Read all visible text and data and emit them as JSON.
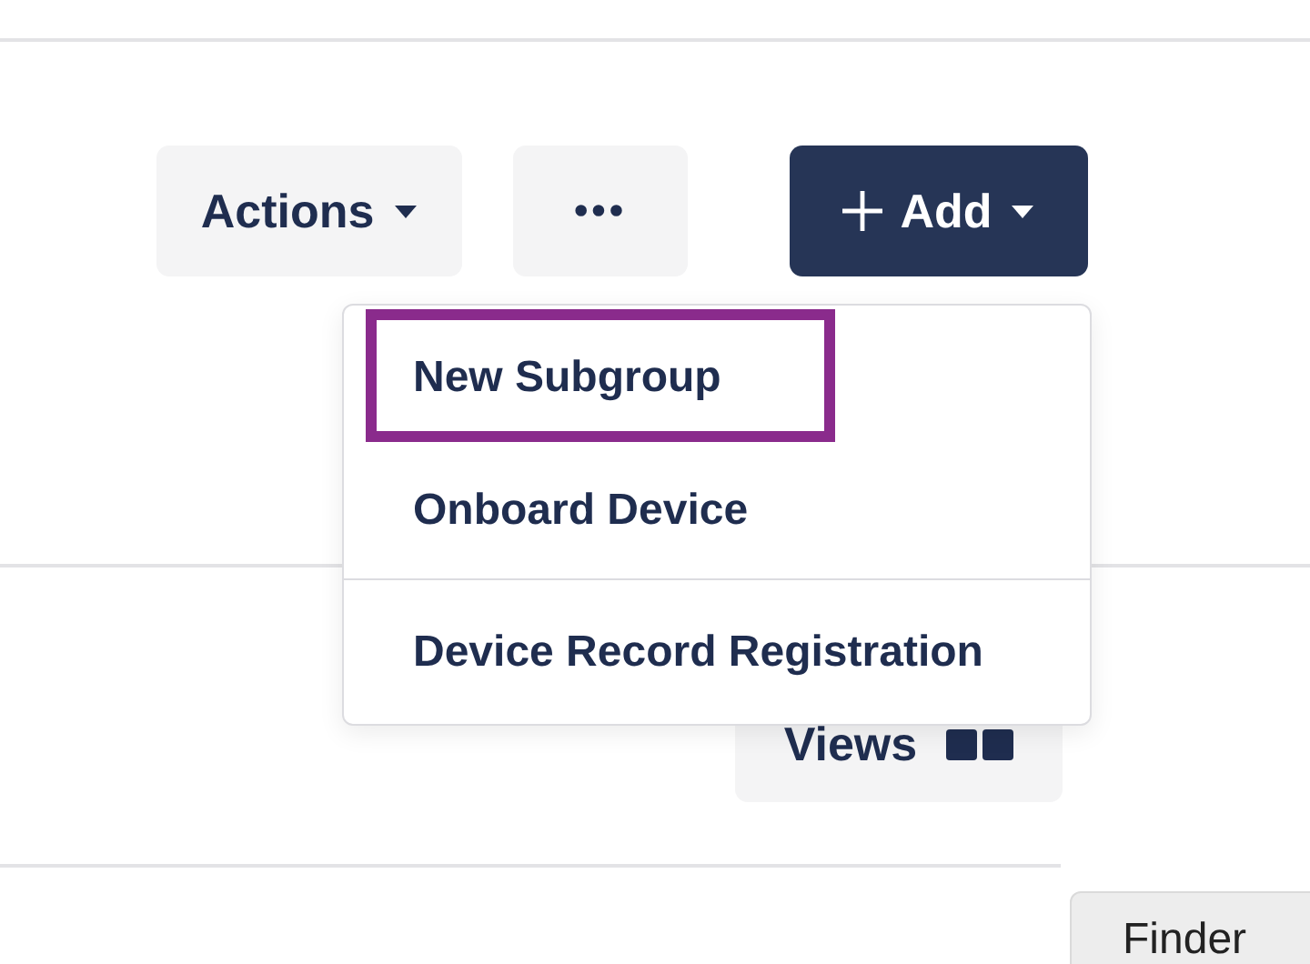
{
  "toolbar": {
    "actions_button": {
      "label": "Actions"
    },
    "more_button": {
      "label": "•••"
    },
    "add_button": {
      "label": "Add"
    }
  },
  "add_menu": {
    "sections": [
      [
        {
          "label": "New Subgroup",
          "selected": true
        },
        {
          "label": "Onboard Device",
          "selected": false
        }
      ],
      [
        {
          "label": "Device Record Registration",
          "selected": false
        }
      ]
    ]
  },
  "views_button": {
    "label": "Views"
  },
  "finder_tab": {
    "label": "Finder"
  }
}
